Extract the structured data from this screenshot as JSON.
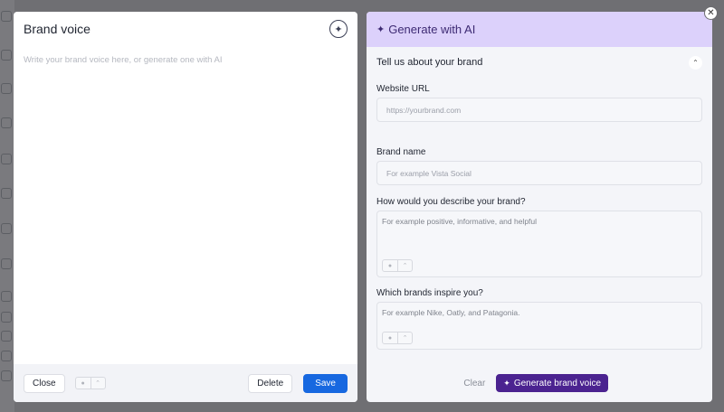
{
  "brand_voice": {
    "title": "Brand voice",
    "editor_placeholder": "Write your brand voice here, or generate one with AI",
    "close_label": "Close",
    "delete_label": "Delete",
    "save_label": "Save"
  },
  "generate_ai": {
    "header_title": "Generate with AI",
    "section_title": "Tell us about your brand",
    "fields": {
      "website_url": {
        "label": "Website URL",
        "placeholder": "https://yourbrand.com"
      },
      "brand_name": {
        "label": "Brand name",
        "placeholder": "For example Vista Social"
      },
      "describe": {
        "label": "How would you describe your brand?",
        "placeholder": "For example positive, informative, and helpful"
      },
      "inspire": {
        "label": "Which brands inspire you?",
        "placeholder": "For example Nike, Oatly, and Patagonia."
      }
    },
    "clear_label": "Clear",
    "generate_label": "Generate brand voice"
  },
  "icons": {
    "sparkle": "✦",
    "close": "✕",
    "chevron_up": "⌃",
    "microphone": "●"
  },
  "colors": {
    "primary": "#1768e0",
    "ai_header_bg": "#dcd1fb",
    "generate_button": "#4b2390"
  }
}
